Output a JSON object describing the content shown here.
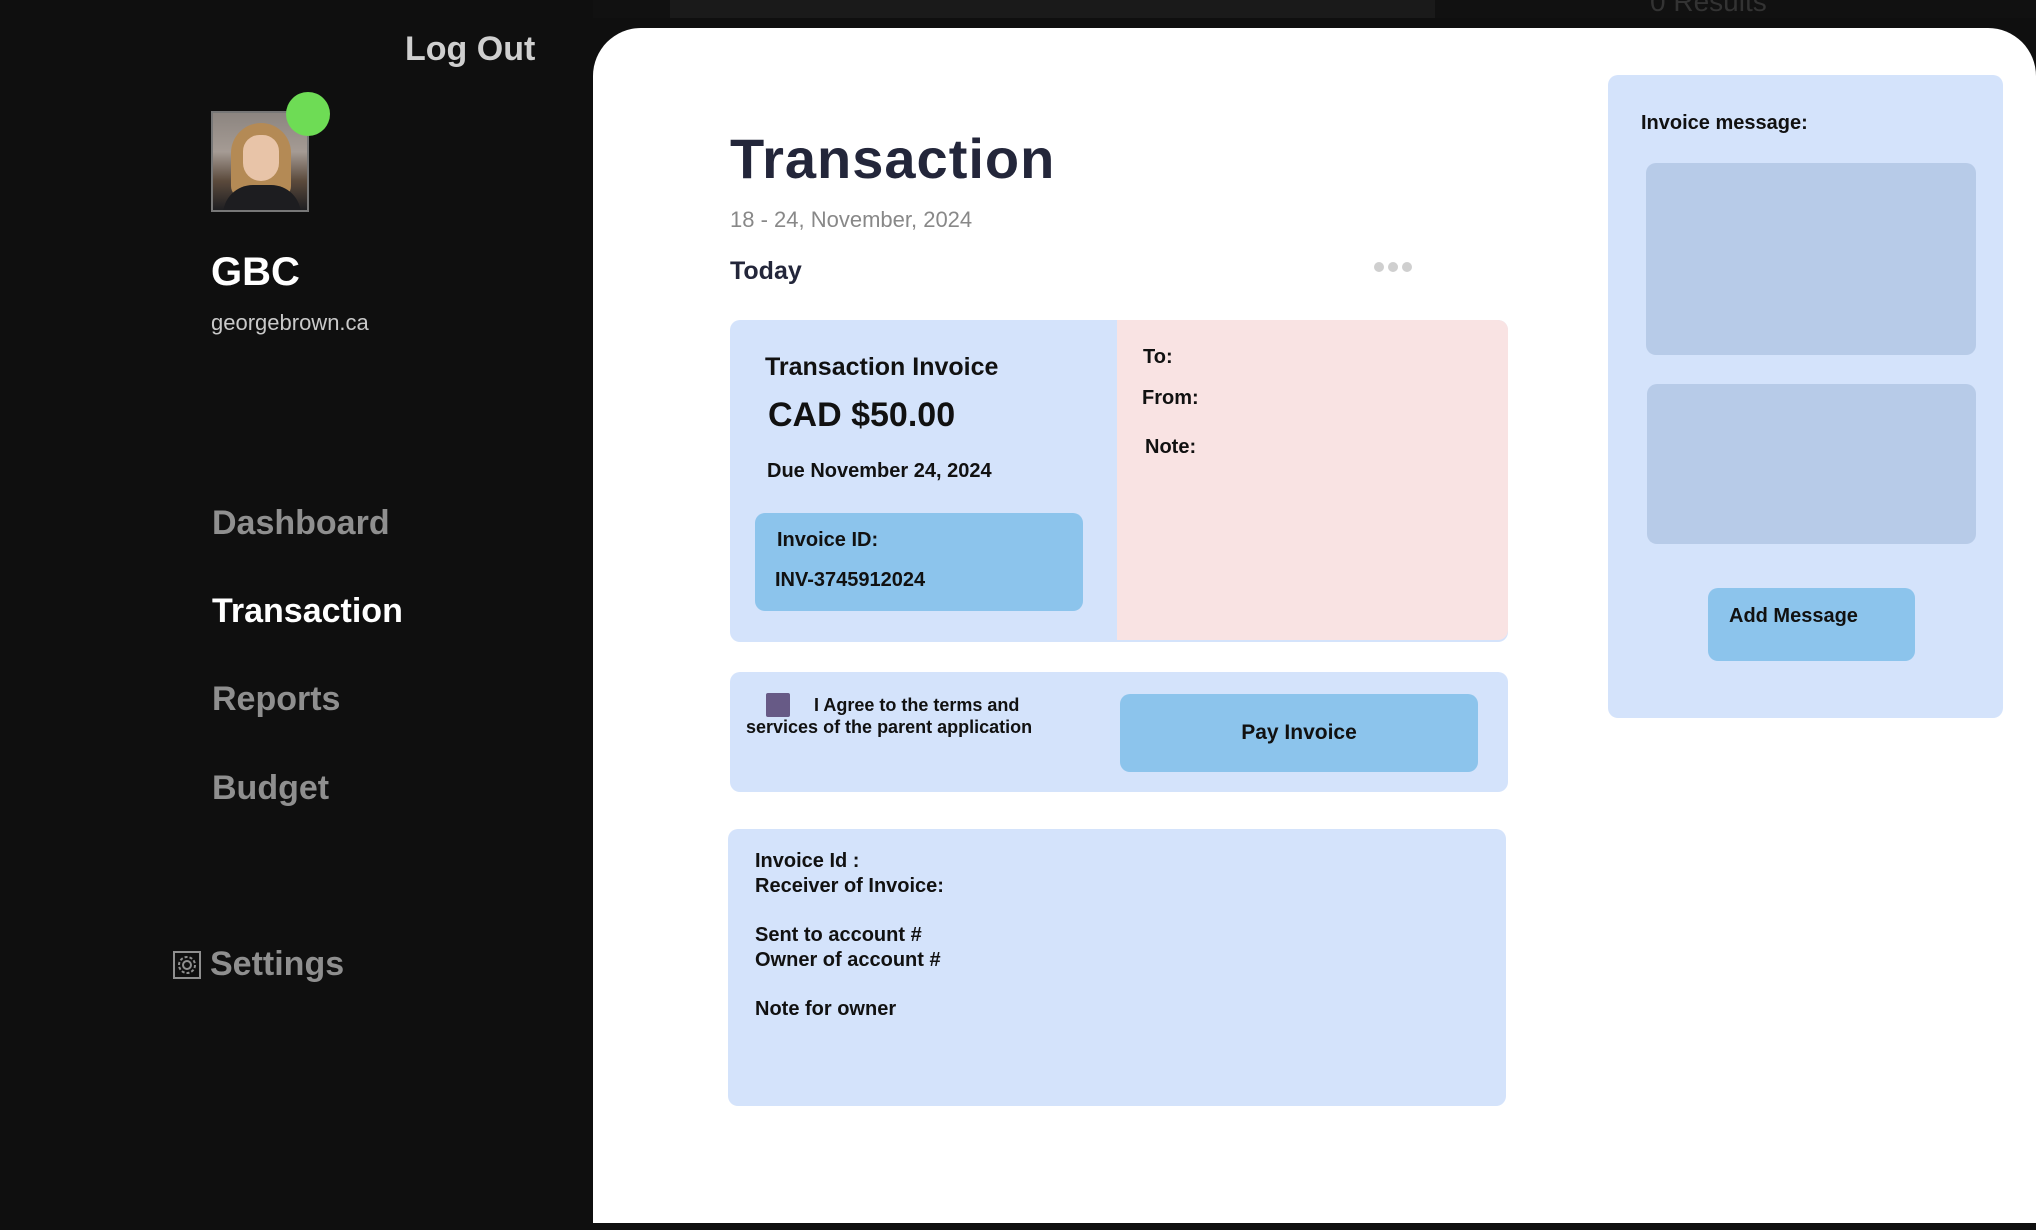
{
  "top_strip": {
    "results_text": "0 Results"
  },
  "sidebar": {
    "logout_label": "Log Out",
    "org_name": "GBC",
    "org_site": "georgebrown.ca",
    "nav": [
      {
        "label": "Dashboard",
        "active": false
      },
      {
        "label": "Transaction",
        "active": true
      },
      {
        "label": "Reports",
        "active": false
      },
      {
        "label": "Budget",
        "active": false
      }
    ],
    "settings_label": "Settings",
    "status_color": "#6edc55"
  },
  "main": {
    "title": "Transaction",
    "date_range": "18 - 24, November, 2024",
    "section_label": "Today"
  },
  "invoice": {
    "title": "Transaction Invoice",
    "amount": "CAD $50.00",
    "due": "Due November 24, 2024",
    "id_label": "Invoice ID:",
    "id_value": "INV-3745912024",
    "to_label": "To:",
    "from_label": "From:",
    "note_label": "Note:"
  },
  "agree": {
    "text": "I Agree to the terms and services of the parent application",
    "pay_label": "Pay Invoice"
  },
  "details": {
    "invoice_id_label": "Invoice Id :",
    "receiver_label": "Receiver of Invoice:",
    "sent_to_label": "Sent to account #",
    "owner_label": "Owner of account #",
    "note_label": "Note for owner"
  },
  "message_panel": {
    "label": "Invoice message:",
    "add_label": "Add Message"
  },
  "colors": {
    "card_bg": "#d4e3fb",
    "accent_button": "#8cc4ec",
    "to_box_bg": "#f9e3e3",
    "checkbox": "#675a86"
  }
}
